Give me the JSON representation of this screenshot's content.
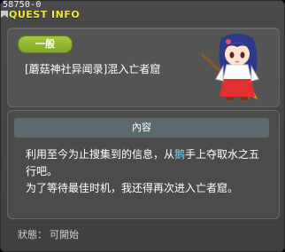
{
  "window": {
    "quest_id": "58750-0",
    "title": "QUEST INFO"
  },
  "quest": {
    "category_badge": "一般",
    "name": "[蘑菇神社异闻录]混入亡者窟"
  },
  "content_section": {
    "header": "內容",
    "line1_part1": "利用至今为止搜集到的信息，从",
    "line1_highlight": "鹅",
    "line1_part2": "手上夺取水之五",
    "line2": "行吧。",
    "line3": "为了等待最佳时机，我还得再次进入亡者窟。"
  },
  "status": {
    "label": "狀態：",
    "value": "可開始"
  },
  "colors": {
    "title": "#f4e43a",
    "badge": "#8fb52f",
    "highlight": "#6ad0ff",
    "section_bar": "#5c6a70"
  },
  "icons": {
    "npc": "shrine-maiden-npc-portrait",
    "title_marker": "ribbon-icon"
  }
}
